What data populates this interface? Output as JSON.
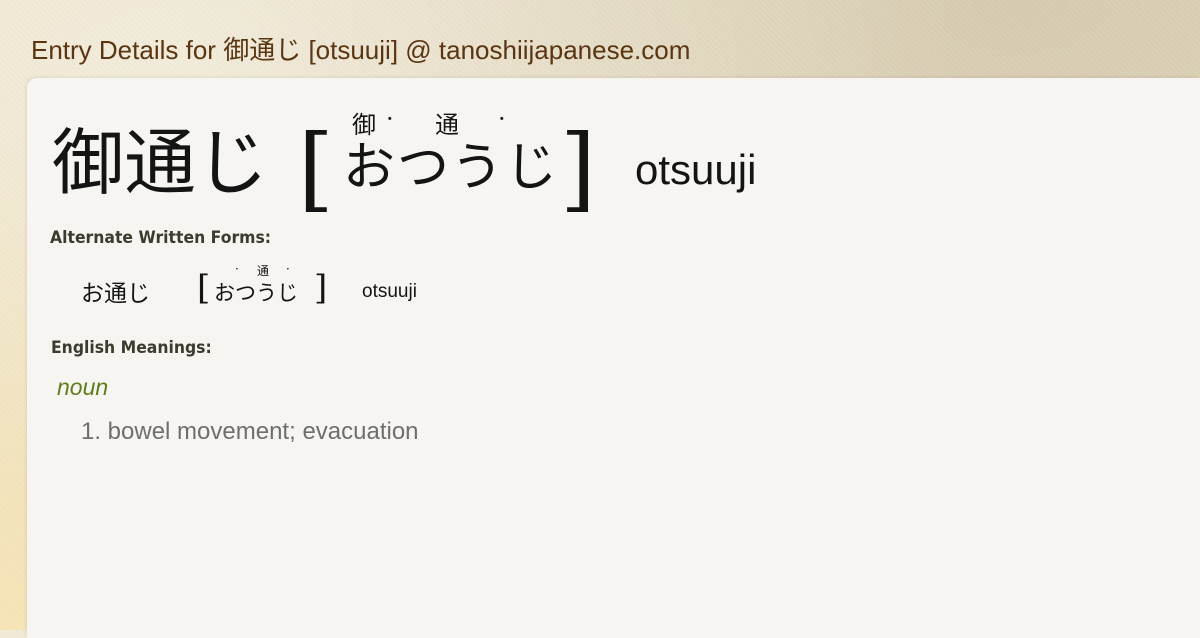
{
  "page": {
    "title_prefix": "Entry Details for",
    "title_word": "御通じ",
    "title_suffix": "[otsuuji] @ tanoshiijapanese.com"
  },
  "entry": {
    "kanji": "御通じ",
    "bracket_open": "[",
    "bracket_close": "]",
    "reading": "おつうじ",
    "furigana": [
      "御",
      "·",
      "通",
      "·"
    ],
    "romaji": "otsuuji"
  },
  "alternate_forms": {
    "label": "Alternate Written Forms:",
    "items": [
      {
        "kanji": "お通じ",
        "reading": "おつうじ",
        "furigana": [
          "·",
          "通",
          "·"
        ],
        "romaji": "otsuuji"
      }
    ]
  },
  "meanings": {
    "label": "English Meanings:",
    "part_of_speech": "noun",
    "definitions": [
      "1. bowel movement; evacuation"
    ]
  },
  "colors": {
    "title": "#5a3512",
    "part_of_speech": "#5e7d1c",
    "definition": "#6e6e6e",
    "card": "#f7f5f1"
  }
}
